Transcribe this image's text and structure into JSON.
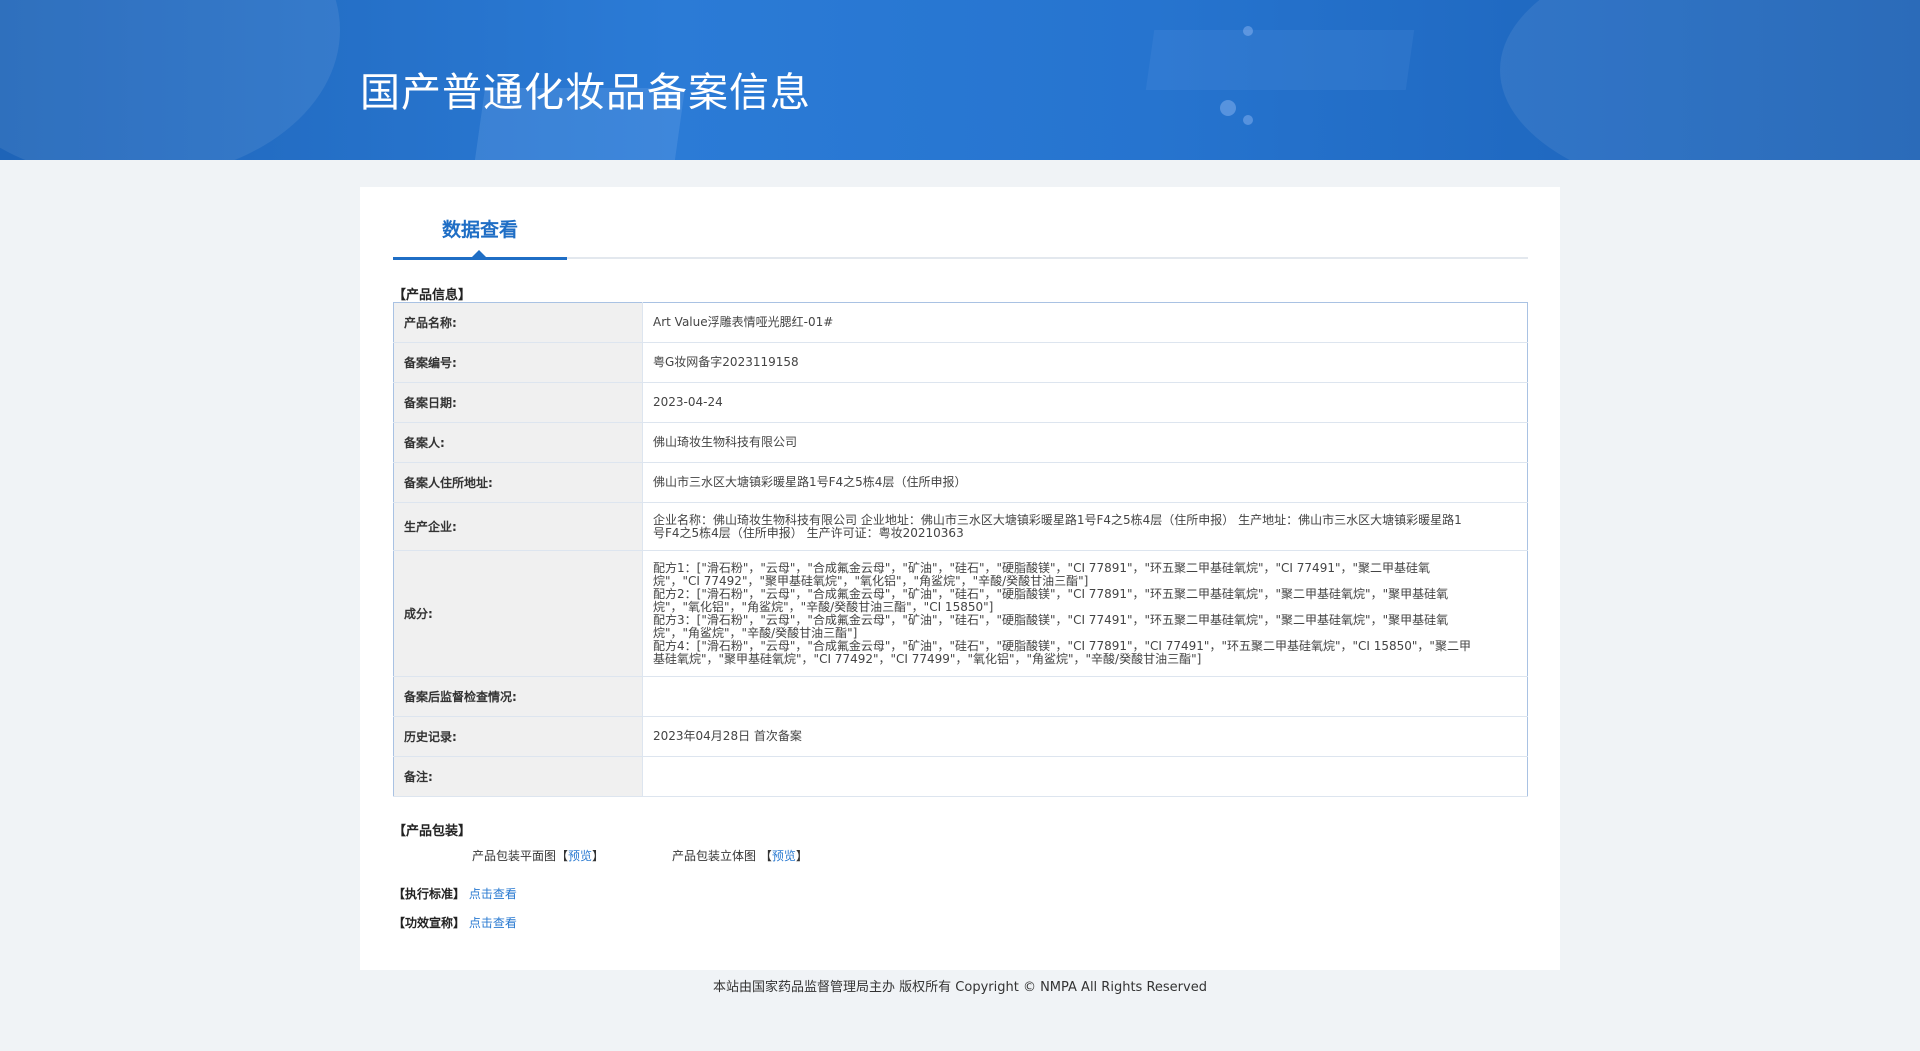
{
  "header": {
    "title": "国产普通化妆品备案信息"
  },
  "tabs": [
    {
      "label": "数据查看"
    }
  ],
  "product_info": {
    "section_title": "【产品信息】",
    "rows": [
      {
        "label": "产品名称:",
        "value": "Art Value浮雕表情哑光腮红-01#"
      },
      {
        "label": "备案编号:",
        "value": "粤G妆网备字2023119158"
      },
      {
        "label": "备案日期:",
        "value": "2023-04-24"
      },
      {
        "label": "备案人:",
        "value": "佛山琦妆生物科技有限公司"
      },
      {
        "label": "备案人住所地址:",
        "value": "佛山市三水区大塘镇彩暖星路1号F4之5栋4层（住所申报）"
      },
      {
        "label": "生产企业:",
        "value": "企业名称：佛山琦妆生物科技有限公司 企业地址：佛山市三水区大塘镇彩暖星路1号F4之5栋4层（住所申报） 生产地址：佛山市三水区大塘镇彩暖星路1号F4之5栋4层（住所申报） 生产许可证：粤妆20210363"
      },
      {
        "label": "成分:",
        "value": "配方1：[\"滑石粉\"，\"云母\"，\"合成氟金云母\"，\"矿油\"，\"硅石\"，\"硬脂酸镁\"，\"CI 77891\"，\"环五聚二甲基硅氧烷\"，\"CI 77491\"，\"聚二甲基硅氧烷\"，\"CI 77492\"，\"聚甲基硅氧烷\"，\"氧化铝\"，\"角鲨烷\"，\"辛酸/癸酸甘油三酯\"]\n配方2：[\"滑石粉\"，\"云母\"，\"合成氟金云母\"，\"矿油\"，\"硅石\"，\"硬脂酸镁\"，\"CI 77891\"，\"环五聚二甲基硅氧烷\"，\"聚二甲基硅氧烷\"，\"聚甲基硅氧烷\"，\"氧化铝\"，\"角鲨烷\"，\"辛酸/癸酸甘油三酯\"，\"CI 15850\"]\n配方3：[\"滑石粉\"，\"云母\"，\"合成氟金云母\"，\"矿油\"，\"硅石\"，\"硬脂酸镁\"，\"CI 77491\"，\"环五聚二甲基硅氧烷\"，\"聚二甲基硅氧烷\"，\"聚甲基硅氧烷\"，\"角鲨烷\"，\"辛酸/癸酸甘油三酯\"]\n配方4：[\"滑石粉\"，\"云母\"，\"合成氟金云母\"，\"矿油\"，\"硅石\"，\"硬脂酸镁\"，\"CI 77891\"，\"CI 77491\"，\"环五聚二甲基硅氧烷\"，\"CI 15850\"，\"聚二甲基硅氧烷\"，\"聚甲基硅氧烷\"，\"CI 77492\"，\"CI 77499\"，\"氧化铝\"，\"角鲨烷\"，\"辛酸/癸酸甘油三酯\"]"
      },
      {
        "label": "备案后监督检查情况:",
        "value": ""
      },
      {
        "label": "历史记录:",
        "value": "2023年04月28日 首次备案"
      },
      {
        "label": "备注:",
        "value": ""
      }
    ]
  },
  "packaging": {
    "section_title": "【产品包装】",
    "flat_label": "产品包装平面图",
    "stereo_label": "产品包装立体图",
    "bracket_open": "【",
    "bracket_close": "】",
    "preview_label": "预览"
  },
  "standard": {
    "label": "【执行标准】",
    "link": "点击查看"
  },
  "efficacy": {
    "label": "【功效宣称】",
    "link": "点击查看"
  },
  "footer": {
    "text": "本站由国家药品监督管理局主办 版权所有 Copyright © NMPA All Rights Reserved"
  },
  "colors": {
    "accent": "#1f6ec5",
    "link": "#2a7ad1",
    "banner": "#2674cf",
    "background": "#f0f3f6"
  }
}
